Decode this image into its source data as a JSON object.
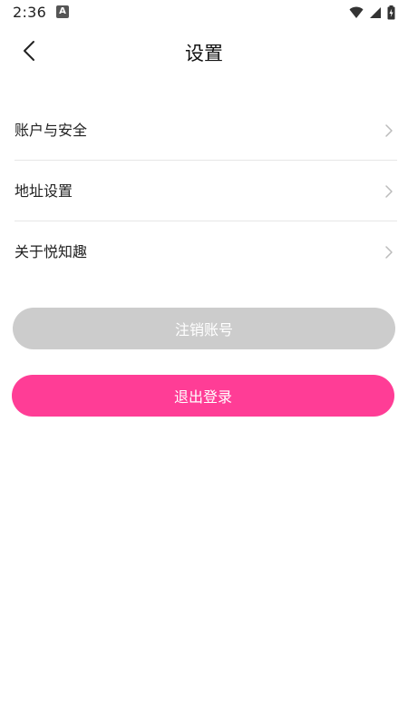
{
  "status_bar": {
    "time": "2:36",
    "notification_glyph": "A",
    "icons": [
      "wifi-icon",
      "signal-icon",
      "battery-icon"
    ]
  },
  "header": {
    "title": "设置",
    "back_icon": "chevron-left-icon"
  },
  "menu": {
    "items": [
      {
        "label": "账户与安全"
      },
      {
        "label": "地址设置"
      },
      {
        "label": "关于悦知趣"
      }
    ],
    "chevron_icon": "chevron-right-icon"
  },
  "buttons": {
    "cancel_account": "注销账号",
    "logout": "退出登录"
  },
  "colors": {
    "accent": "#ff3d96",
    "disabled": "#cccccc",
    "divider": "#e6e6e6"
  }
}
